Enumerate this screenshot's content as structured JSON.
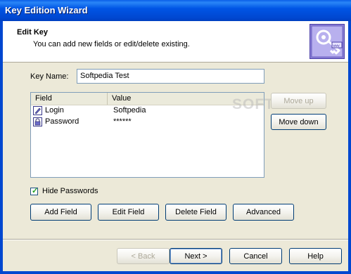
{
  "window": {
    "title": "Key Edition Wizard"
  },
  "header": {
    "title": "Edit Key",
    "subtitle": "You can add new fields or edit/delete existing."
  },
  "key_name": {
    "label": "Key Name:",
    "value": "Softpedia Test"
  },
  "list": {
    "columns": [
      "Field",
      "Value"
    ],
    "rows": [
      {
        "field": "Login",
        "value": "Softpedia",
        "icon": "pen-icon"
      },
      {
        "field": "Password",
        "value": "******",
        "icon": "lock-icon"
      }
    ]
  },
  "side_buttons": {
    "move_up": "Move up",
    "move_down": "Move down"
  },
  "hide_passwords": {
    "label": "Hide Passwords",
    "checked": true
  },
  "field_buttons": {
    "add": "Add Field",
    "edit": "Edit Field",
    "delete": "Delete Field",
    "advanced": "Advanced"
  },
  "nav_buttons": {
    "back": "< Back",
    "next": "Next >",
    "cancel": "Cancel",
    "help": "Help"
  },
  "watermark": "SOFTPEDIA"
}
